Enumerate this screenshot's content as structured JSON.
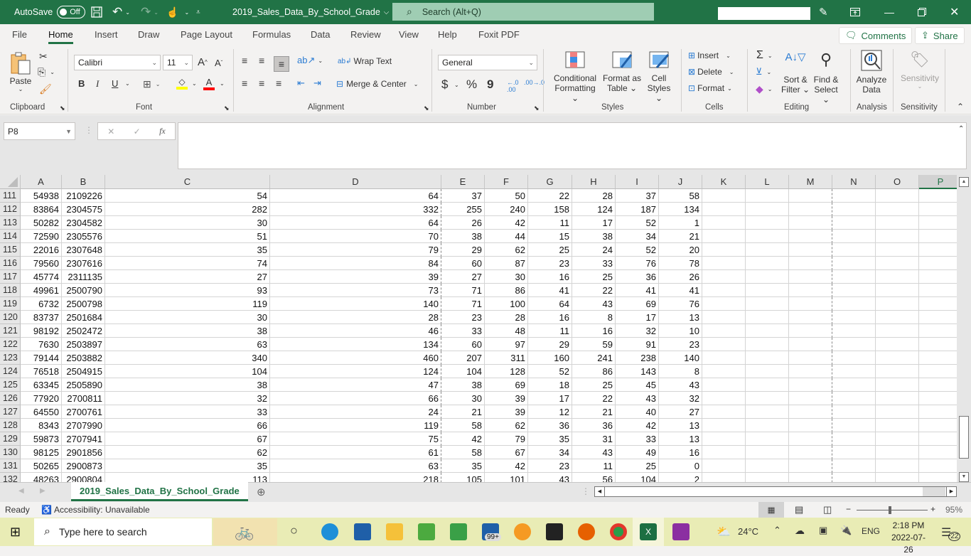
{
  "titlebar": {
    "autosave_label": "AutoSave",
    "autosave_state": "Off",
    "filename": "2019_Sales_Data_By_School_Grade",
    "search_placeholder": "Search (Alt+Q)",
    "controls": [
      "pen-icon",
      "ribbon-display-icon",
      "minimize-icon",
      "restore-icon",
      "close-icon"
    ]
  },
  "menu": {
    "tabs": [
      "File",
      "Home",
      "Insert",
      "Draw",
      "Page Layout",
      "Formulas",
      "Data",
      "Review",
      "View",
      "Help",
      "Foxit PDF"
    ],
    "active": "Home",
    "comments": "Comments",
    "share": "Share"
  },
  "ribbon": {
    "clipboard": {
      "label": "Clipboard",
      "paste": "Paste"
    },
    "font": {
      "label": "Font",
      "name": "Calibri",
      "size": "11",
      "bold": "B",
      "italic": "I",
      "underline": "U",
      "fill_color": "#ffff00",
      "font_color": "#ff0000"
    },
    "alignment": {
      "label": "Alignment",
      "wrap": "Wrap Text",
      "merge": "Merge & Center"
    },
    "number": {
      "label": "Number",
      "format": "General",
      "currency": "$",
      "percent": "%",
      "comma": "9"
    },
    "styles": {
      "label": "Styles",
      "conditional": [
        "Conditional",
        "Formatting"
      ],
      "format_table": [
        "Format as",
        "Table"
      ],
      "cell_styles": [
        "Cell",
        "Styles"
      ]
    },
    "cells": {
      "label": "Cells",
      "insert": "Insert",
      "delete": "Delete",
      "format": "Format"
    },
    "editing": {
      "label": "Editing",
      "sort": [
        "Sort &",
        "Filter"
      ],
      "find": [
        "Find &",
        "Select"
      ]
    },
    "analysis": {
      "label": "Analysis",
      "analyze": [
        "Analyze",
        "Data"
      ]
    },
    "sensitivity": {
      "label": "Sensitivity",
      "btn": "Sensitivity"
    }
  },
  "formula_bar": {
    "name_box": "P8",
    "fx": "fx",
    "value": ""
  },
  "sheet": {
    "columns": [
      "A",
      "B",
      "C",
      "D",
      "E",
      "F",
      "G",
      "H",
      "I",
      "J",
      "K",
      "L",
      "M",
      "N",
      "O",
      "P"
    ],
    "selected_column": "P",
    "rows": [
      {
        "n": "111",
        "v": [
          "54938",
          "2109226",
          "54",
          "64",
          "37",
          "50",
          "22",
          "28",
          "37",
          "58"
        ]
      },
      {
        "n": "112",
        "v": [
          "83864",
          "2304575",
          "282",
          "332",
          "255",
          "240",
          "158",
          "124",
          "187",
          "134"
        ]
      },
      {
        "n": "113",
        "v": [
          "50282",
          "2304582",
          "30",
          "64",
          "26",
          "42",
          "11",
          "17",
          "52",
          "1"
        ]
      },
      {
        "n": "114",
        "v": [
          "72590",
          "2305576",
          "51",
          "70",
          "38",
          "44",
          "15",
          "38",
          "34",
          "21"
        ]
      },
      {
        "n": "115",
        "v": [
          "22016",
          "2307648",
          "35",
          "79",
          "29",
          "62",
          "25",
          "24",
          "52",
          "20"
        ]
      },
      {
        "n": "116",
        "v": [
          "79560",
          "2307616",
          "74",
          "84",
          "60",
          "87",
          "23",
          "33",
          "76",
          "78"
        ]
      },
      {
        "n": "117",
        "v": [
          "45774",
          "2311135",
          "27",
          "39",
          "27",
          "30",
          "16",
          "25",
          "36",
          "26"
        ]
      },
      {
        "n": "118",
        "v": [
          "49961",
          "2500790",
          "93",
          "73",
          "71",
          "86",
          "41",
          "22",
          "41",
          "41"
        ]
      },
      {
        "n": "119",
        "v": [
          "6732",
          "2500798",
          "119",
          "140",
          "71",
          "100",
          "64",
          "43",
          "69",
          "76"
        ]
      },
      {
        "n": "120",
        "v": [
          "83737",
          "2501684",
          "30",
          "28",
          "23",
          "28",
          "16",
          "8",
          "17",
          "13"
        ]
      },
      {
        "n": "121",
        "v": [
          "98192",
          "2502472",
          "38",
          "46",
          "33",
          "48",
          "11",
          "16",
          "32",
          "10"
        ]
      },
      {
        "n": "122",
        "v": [
          "7630",
          "2503897",
          "63",
          "134",
          "60",
          "97",
          "29",
          "59",
          "91",
          "23"
        ]
      },
      {
        "n": "123",
        "v": [
          "79144",
          "2503882",
          "340",
          "460",
          "207",
          "311",
          "160",
          "241",
          "238",
          "140"
        ]
      },
      {
        "n": "124",
        "v": [
          "76518",
          "2504915",
          "104",
          "124",
          "104",
          "128",
          "52",
          "86",
          "143",
          "8"
        ]
      },
      {
        "n": "125",
        "v": [
          "63345",
          "2505890",
          "38",
          "47",
          "38",
          "69",
          "18",
          "25",
          "45",
          "43"
        ]
      },
      {
        "n": "126",
        "v": [
          "77920",
          "2700811",
          "32",
          "66",
          "30",
          "39",
          "17",
          "22",
          "43",
          "32"
        ]
      },
      {
        "n": "127",
        "v": [
          "64550",
          "2700761",
          "33",
          "24",
          "21",
          "39",
          "12",
          "21",
          "40",
          "27"
        ]
      },
      {
        "n": "128",
        "v": [
          "8343",
          "2707990",
          "66",
          "119",
          "58",
          "62",
          "36",
          "36",
          "42",
          "13"
        ]
      },
      {
        "n": "129",
        "v": [
          "59873",
          "2707941",
          "67",
          "75",
          "42",
          "79",
          "35",
          "31",
          "33",
          "13"
        ]
      },
      {
        "n": "130",
        "v": [
          "98125",
          "2901856",
          "62",
          "61",
          "58",
          "67",
          "34",
          "43",
          "49",
          "16"
        ]
      },
      {
        "n": "131",
        "v": [
          "50265",
          "2900873",
          "35",
          "63",
          "35",
          "42",
          "23",
          "11",
          "25",
          "0"
        ]
      },
      {
        "n": "132",
        "v": [
          "48263",
          "2900804",
          "113",
          "218",
          "105",
          "101",
          "43",
          "56",
          "104",
          "2"
        ]
      }
    ],
    "tab_name": "2019_Sales_Data_By_School_Grade"
  },
  "status": {
    "ready": "Ready",
    "accessibility": "Accessibility: Unavailable",
    "zoom": "95%",
    "zoom_fraction": 0.45
  },
  "taskbar": {
    "search_placeholder": "Type here to search",
    "mail_badge": "99+",
    "weather": "24°C",
    "lang": "ENG",
    "time": "2:18 PM",
    "date": "2022-07-26",
    "notifications": "22"
  }
}
